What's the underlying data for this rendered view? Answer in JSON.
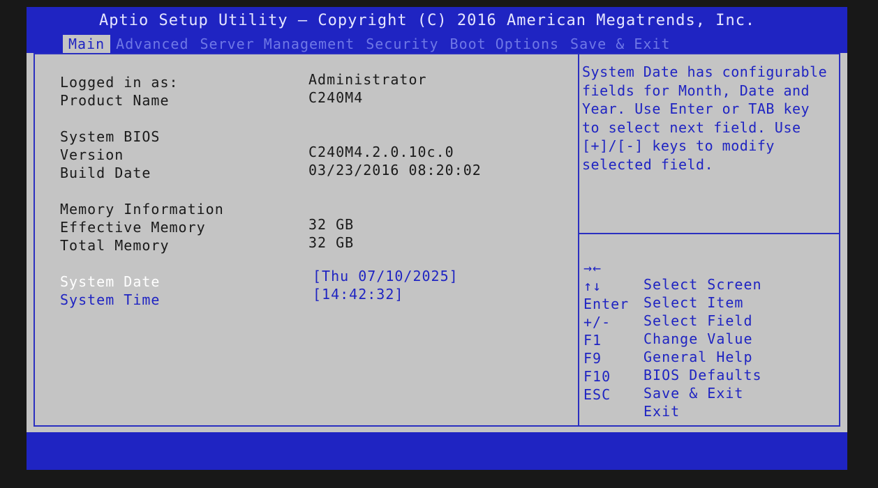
{
  "header": {
    "title": "Aptio Setup Utility – Copyright (C) 2016 American Megatrends, Inc.",
    "tabs": [
      {
        "label": "Main"
      },
      {
        "label": "Advanced"
      },
      {
        "label": "Server Management"
      },
      {
        "label": "Security"
      },
      {
        "label": "Boot Options"
      },
      {
        "label": "Save & Exit"
      }
    ]
  },
  "main": {
    "logged_in_label": "Logged in as:",
    "logged_in_value": "Administrator",
    "product_name_label": "Product Name",
    "product_name_value": "C240M4",
    "system_bios_heading": "System BIOS",
    "version_label": "Version",
    "version_value": "C240M4.2.0.10c.0",
    "build_date_label": "Build Date",
    "build_date_value": "03/23/2016 08:20:02",
    "memory_heading": "Memory Information",
    "effective_memory_label": "Effective Memory",
    "effective_memory_value": "32 GB",
    "total_memory_label": "Total Memory",
    "total_memory_value": "32 GB",
    "system_date_label": "System Date",
    "system_date_value": "[Thu 07/10/2025]",
    "system_time_label": "System Time",
    "system_time_value": "[14:42:32]"
  },
  "help": {
    "text": "System Date has configurable fields for Month, Date and Year. Use Enter or TAB key to select next field. Use [+]/[-] keys to modify selected field."
  },
  "keys": [
    {
      "key": "→←",
      "desc": "Select Screen"
    },
    {
      "key": "↑↓",
      "desc": "Select Item"
    },
    {
      "key": "Enter",
      "desc": "Select Field"
    },
    {
      "key": "+/-",
      "desc": "Change Value"
    },
    {
      "key": "F1",
      "desc": "General Help"
    },
    {
      "key": "F9",
      "desc": "BIOS Defaults"
    },
    {
      "key": "F10",
      "desc": "Save & Exit"
    },
    {
      "key": "ESC",
      "desc": "Exit"
    }
  ],
  "colors": {
    "bios_blue": "#1f24c2",
    "panel_gray": "#c4c4c4",
    "selected_text": "#ffffff"
  }
}
